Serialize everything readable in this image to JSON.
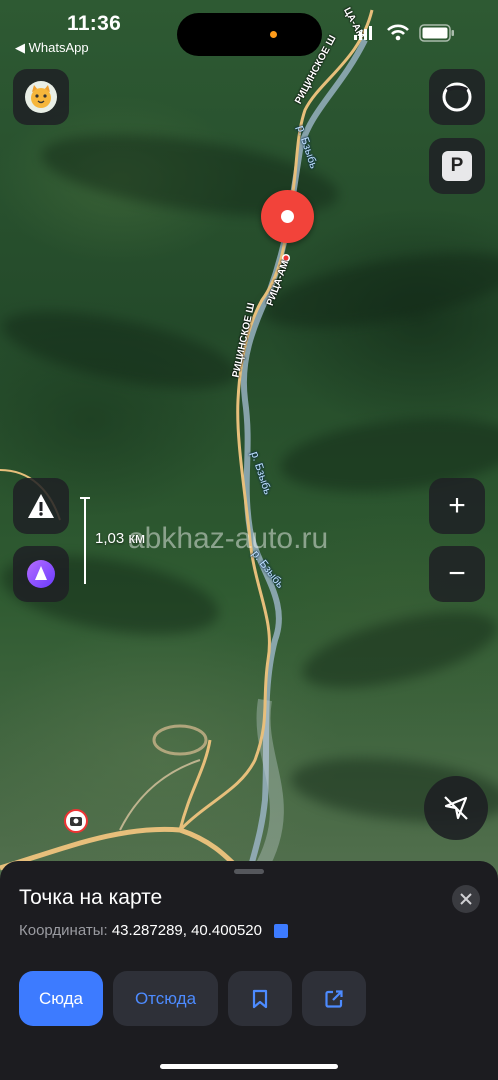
{
  "status_bar": {
    "time": "11:36",
    "back_app": "◀ WhatsApp"
  },
  "map": {
    "scale_label": "1,03 км",
    "watermark": "abkhaz-auto.ru",
    "road_labels": [
      "ЦА-АМ",
      "РИЦИНСКОЕ Ш",
      "РИЦА-АМ",
      "РИЦИНСКОЕ Ш"
    ],
    "river_labels": [
      "р. Бзыбь",
      "р. Бзыбь",
      "р. Бзыбь"
    ]
  },
  "controls": {
    "profile_icon": "cat-face-icon",
    "layers_icon": "layers-circle-icon",
    "parking_label": "P",
    "alert_icon": "warning-triangle-icon",
    "alice_icon": "alice-assistant-icon",
    "zoom_in_label": "+",
    "zoom_out_label": "−",
    "compass_icon": "location-off-icon"
  },
  "sheet": {
    "title": "Точка на карте",
    "coords_label": "Координаты:",
    "coords_value": "43.287289, 40.400520",
    "here_label": "Сюда",
    "from_label": "Отсюда",
    "bookmark_icon": "bookmark-icon",
    "share_icon": "share-icon"
  },
  "colors": {
    "accent": "#3d7bff",
    "pin": "#f2433a",
    "sheet_bg": "#1c1c20"
  }
}
